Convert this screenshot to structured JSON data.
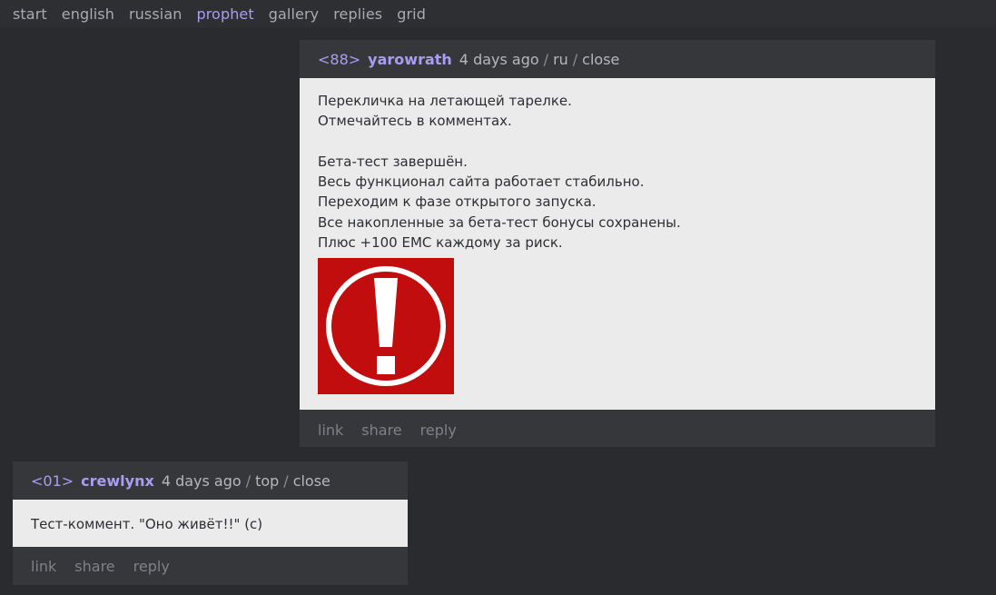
{
  "nav": {
    "items": [
      "start",
      "english",
      "russian",
      "prophet",
      "gallery",
      "replies",
      "grid"
    ],
    "active": "prophet"
  },
  "post1": {
    "num": "<88>",
    "author": "yarowrath",
    "time": "4 days ago",
    "tag": "ru",
    "close": "close",
    "lines": [
      "Перекличка на летающей тарелке.",
      "Отмечайтесь в комментах.",
      "",
      "Бета-тест завершён.",
      "Весь функционал сайта работает стабильно.",
      "Переходим к фазе открытого запуска.",
      "Все накопленные за бета-тест бонусы сохранены.",
      "Плюс +100 EMC каждому за риск."
    ],
    "image_icon": "exclamation-circle-icon",
    "actions": {
      "link": "link",
      "share": "share",
      "reply": "reply"
    }
  },
  "post2": {
    "num": "<01>",
    "author": "crewlynx",
    "time": "4 days ago",
    "tag": "top",
    "close": "close",
    "text": "Тест-коммент. \"Оно живёт!!\" (с)",
    "actions": {
      "link": "link",
      "share": "share",
      "reply": "reply"
    }
  },
  "colors": {
    "background": "#2a2b2e",
    "panel": "#36373b",
    "accent": "#a89cf5",
    "body": "#ebebeb",
    "alert": "#c10d0d"
  }
}
